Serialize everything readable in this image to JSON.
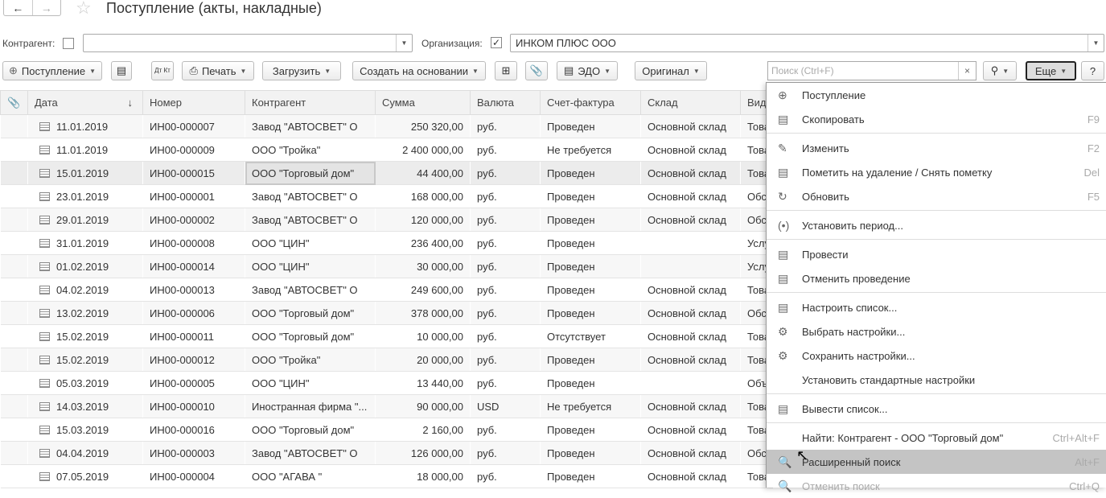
{
  "title": "Поступление (акты, накладные)",
  "filters": {
    "counterparty_label": "Контрагент:",
    "counterparty_value": "",
    "organization_label": "Организация:",
    "organization_value": "ИНКОМ ПЛЮС ООО"
  },
  "toolbar": {
    "create": "Поступление",
    "print": "Печать",
    "load": "Загрузить",
    "create_based": "Создать на основании",
    "edo": "ЭДО",
    "original": "Оригинал",
    "dtkt": "Дт Кт",
    "search_placeholder": "Поиск (Ctrl+F)",
    "more": "Еще",
    "help": "?"
  },
  "columns": [
    "Дата",
    "Номер",
    "Контрагент",
    "Сумма",
    "Валюта",
    "Счет-фактура",
    "Склад",
    "Вид"
  ],
  "rows": [
    [
      "11.01.2019",
      "ИН00-000007",
      "Завод \"АВТОСВЕТ\" О",
      "250 320,00",
      "руб.",
      "Проведен",
      "Основной склад",
      "Това"
    ],
    [
      "11.01.2019",
      "ИН00-000009",
      "ООО \"Тройка\"",
      "2 400 000,00",
      "руб.",
      "Не требуется",
      "Основной склад",
      "Това"
    ],
    [
      "15.01.2019",
      "ИН00-000015",
      "ООО \"Торговый дом\"",
      "44 400,00",
      "руб.",
      "Проведен",
      "Основной склад",
      "Това"
    ],
    [
      "23.01.2019",
      "ИН00-000001",
      "Завод \"АВТОСВЕТ\" О",
      "168 000,00",
      "руб.",
      "Проведен",
      "Основной склад",
      "Обс"
    ],
    [
      "29.01.2019",
      "ИН00-000002",
      "Завод \"АВТОСВЕТ\" О",
      "120 000,00",
      "руб.",
      "Проведен",
      "Основной склад",
      "Обс"
    ],
    [
      "31.01.2019",
      "ИН00-000008",
      "ООО \"ЦИН\"",
      "236 400,00",
      "руб.",
      "Проведен",
      "",
      "Услу"
    ],
    [
      "01.02.2019",
      "ИН00-000014",
      "ООО \"ЦИН\"",
      "30 000,00",
      "руб.",
      "Проведен",
      "",
      "Услу"
    ],
    [
      "04.02.2019",
      "ИН00-000013",
      "Завод \"АВТОСВЕТ\" О",
      "249 600,00",
      "руб.",
      "Проведен",
      "Основной склад",
      "Това"
    ],
    [
      "13.02.2019",
      "ИН00-000006",
      "ООО \"Торговый дом\"",
      "378 000,00",
      "руб.",
      "Проведен",
      "Основной склад",
      "Обс"
    ],
    [
      "15.02.2019",
      "ИН00-000011",
      "ООО \"Торговый дом\"",
      "10 000,00",
      "руб.",
      "Отсутствует",
      "Основной склад",
      "Това"
    ],
    [
      "15.02.2019",
      "ИН00-000012",
      "ООО \"Тройка\"",
      "20 000,00",
      "руб.",
      "Проведен",
      "Основной склад",
      "Това"
    ],
    [
      "05.03.2019",
      "ИН00-000005",
      "ООО \"ЦИН\"",
      "13 440,00",
      "руб.",
      "Проведен",
      "",
      "Объ"
    ],
    [
      "14.03.2019",
      "ИН00-000010",
      "Иностранная фирма \"...",
      "90 000,00",
      "USD",
      "Не требуется",
      "Основной склад",
      "Това"
    ],
    [
      "15.03.2019",
      "ИН00-000016",
      "ООО \"Торговый дом\"",
      "2 160,00",
      "руб.",
      "Проведен",
      "Основной склад",
      "Това"
    ],
    [
      "04.04.2019",
      "ИН00-000003",
      "Завод \"АВТОСВЕТ\" О",
      "126 000,00",
      "руб.",
      "Проведен",
      "Основной склад",
      "Обс"
    ],
    [
      "07.05.2019",
      "ИН00-000004",
      "ООО \"АГАВА \"",
      "18 000,00",
      "руб.",
      "Проведен",
      "Основной склад",
      "Това"
    ]
  ],
  "menu": [
    {
      "label": "Поступление",
      "shortcut": "",
      "icon": "plus-circle-icon",
      "glyph": "⊕"
    },
    {
      "label": "Скопировать",
      "shortcut": "F9",
      "icon": "copy-icon",
      "glyph": "▤"
    },
    {
      "sep": true
    },
    {
      "label": "Изменить",
      "shortcut": "F2",
      "icon": "pencil-icon",
      "glyph": "✎"
    },
    {
      "label": "Пометить на удаление / Снять пометку",
      "shortcut": "Del",
      "icon": "delete-mark-icon",
      "glyph": "▤"
    },
    {
      "label": "Обновить",
      "shortcut": "F5",
      "icon": "refresh-icon",
      "glyph": "↻"
    },
    {
      "sep": true
    },
    {
      "label": "Установить период...",
      "shortcut": "",
      "icon": "period-icon",
      "glyph": "(•)"
    },
    {
      "sep": true
    },
    {
      "label": "Провести",
      "shortcut": "",
      "icon": "post-icon",
      "glyph": "▤"
    },
    {
      "label": "Отменить проведение",
      "shortcut": "",
      "icon": "unpost-icon",
      "glyph": "▤"
    },
    {
      "sep": true
    },
    {
      "label": "Настроить список...",
      "shortcut": "",
      "icon": "list-settings-icon",
      "glyph": "▤"
    },
    {
      "label": "Выбрать настройки...",
      "shortcut": "",
      "icon": "load-settings-icon",
      "glyph": "⚙"
    },
    {
      "label": "Сохранить настройки...",
      "shortcut": "",
      "icon": "save-settings-icon",
      "glyph": "⚙"
    },
    {
      "label": "Установить стандартные настройки",
      "shortcut": "",
      "icon": "",
      "glyph": ""
    },
    {
      "sep": true
    },
    {
      "label": "Вывести список...",
      "shortcut": "",
      "icon": "print-list-icon",
      "glyph": "▤"
    },
    {
      "sep": true
    },
    {
      "label": "Найти: Контрагент - ООО \"Торговый дом\"",
      "shortcut": "Ctrl+Alt+F",
      "icon": "",
      "glyph": ""
    },
    {
      "label": "Расширенный поиск",
      "shortcut": "Alt+F",
      "icon": "search-icon",
      "glyph": "🔍",
      "highlighted": true
    },
    {
      "label": "Отменить поиск",
      "shortcut": "Ctrl+Q",
      "icon": "cancel-search-icon",
      "glyph": "🔍",
      "disabled": true
    }
  ]
}
